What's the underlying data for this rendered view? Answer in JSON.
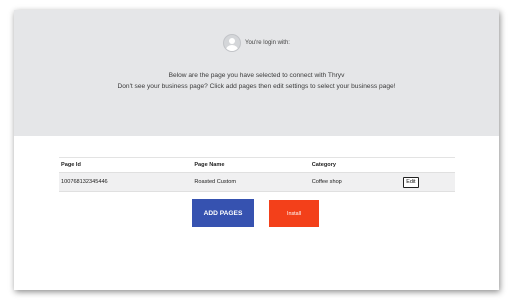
{
  "header": {
    "login_text": "You're login with:"
  },
  "messages": {
    "line1": "Below are the page you have selected to connect with Thryv",
    "line2": "Don't see your business page? Click add pages then edit settings to select your business page!"
  },
  "table": {
    "columns": [
      "Page Id",
      "Page Name",
      "Category",
      ""
    ],
    "rows": [
      {
        "page_id": "100768132345446",
        "page_name": "Roasted Custom",
        "category": "Coffee shop",
        "action": "Edit"
      }
    ]
  },
  "buttons": {
    "add_pages": "ADD PAGES",
    "install": "Install"
  },
  "colors": {
    "top_background": "#e5e6e8",
    "add_pages": "#3652b0",
    "install": "#f3401a"
  },
  "icons": {
    "avatar": "user-avatar-icon"
  }
}
